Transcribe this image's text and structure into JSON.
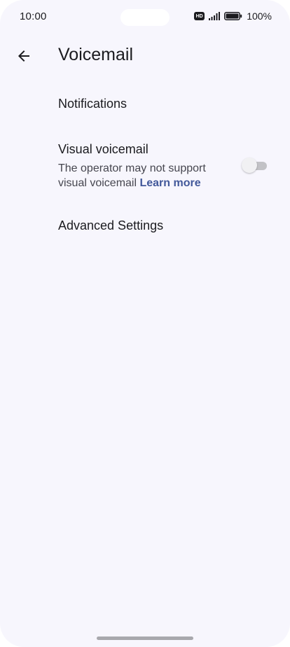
{
  "status_bar": {
    "time": "10:00",
    "hd_badge": "HD",
    "battery_text": "100%",
    "icons": [
      "hd-icon",
      "signal-icon",
      "battery-icon"
    ]
  },
  "app_bar": {
    "back_icon": "arrow-back-icon",
    "title": "Voicemail"
  },
  "settings": {
    "notifications": {
      "title": "Notifications"
    },
    "visual_voicemail": {
      "title": "Visual voicemail",
      "summary": "The operator may not support visual voicemail",
      "learn_more": "Learn more",
      "enabled": false
    },
    "advanced": {
      "title": "Advanced Settings"
    }
  },
  "colors": {
    "background": "#f7f6fd",
    "text_primary": "#1b1b1f",
    "text_secondary": "#46464f",
    "link": "#42589a",
    "toggle_track_off": "#c2c2c6",
    "toggle_thumb_off": "#f1f1f3"
  }
}
